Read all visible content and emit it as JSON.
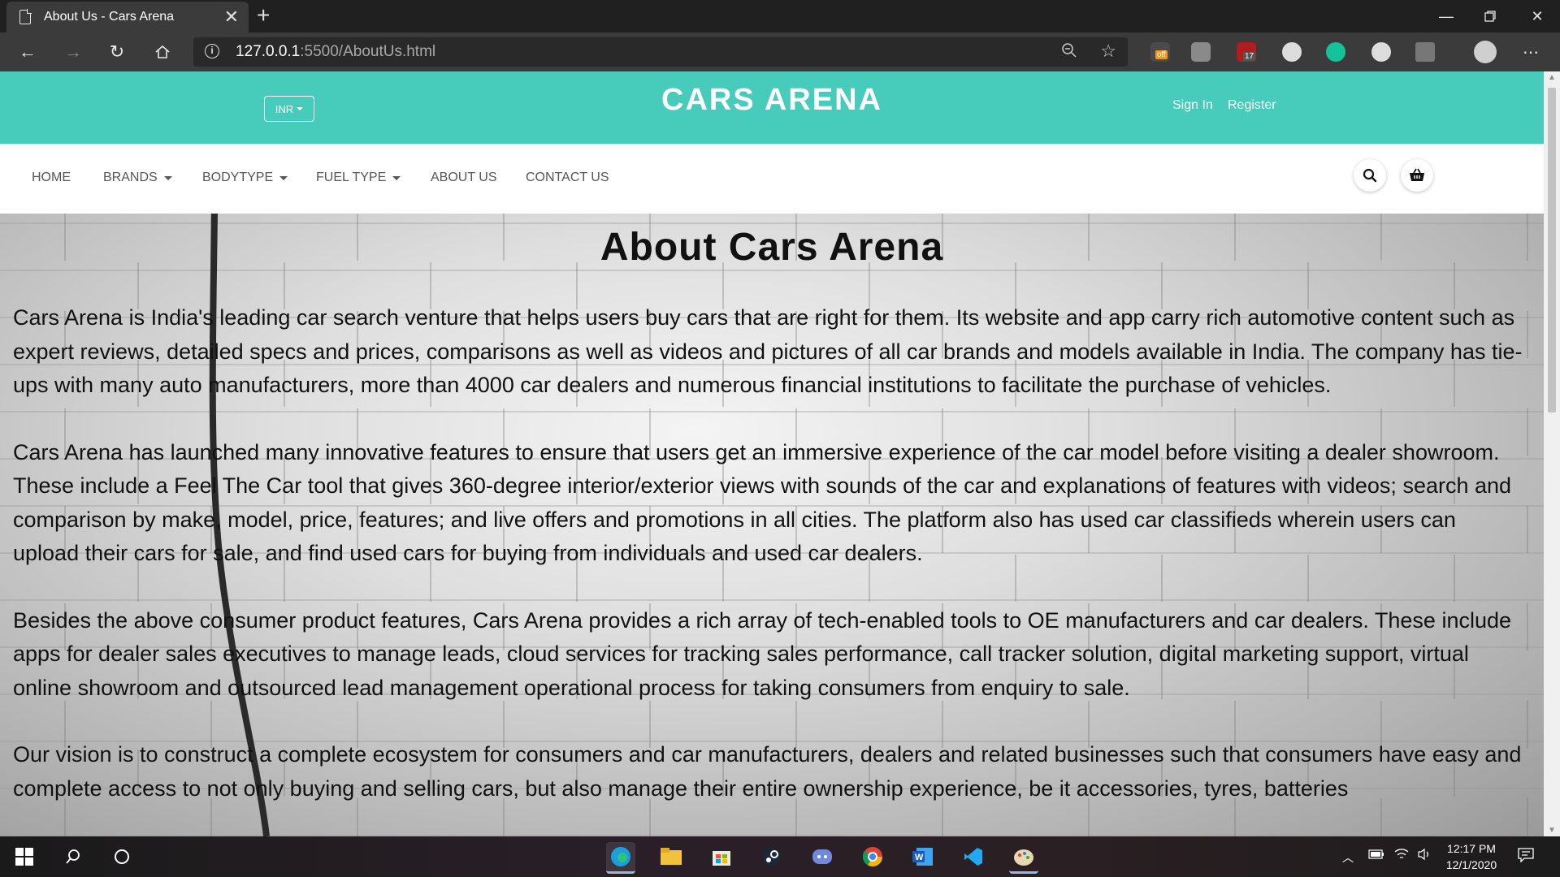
{
  "browser": {
    "tab_title": "About Us - Cars Arena",
    "url_host": "127.0.0.1",
    "url_rest": ":5500/AboutUs.html",
    "extension_badges": {
      "off": "off",
      "count": "17"
    }
  },
  "header": {
    "currency": "INR",
    "logo": "CARS ARENA",
    "sign_in": "Sign In",
    "register": "Register"
  },
  "nav": {
    "items": [
      "HOME",
      "BRANDS",
      "BODYTYPE",
      "FUEL TYPE",
      "ABOUT US",
      "CONTACT US"
    ]
  },
  "about": {
    "title": "About Cars Arena",
    "paragraphs": [
      "Cars Arena is India's leading car search venture that helps users buy cars that are right for them. Its website and app carry rich automotive content such as expert reviews, detailed specs and prices, comparisons as well as videos and pictures of all car brands and models available in India. The company has tie-ups with many auto manufacturers, more than 4000 car dealers and numerous financial institutions to facilitate the purchase of vehicles.",
      "Cars Arena has launched many innovative features to ensure that users get an immersive experience of the car model before visiting a dealer showroom. These include a Feel The Car tool that gives 360-degree interior/exterior views with sounds of the car and explanations of features with videos; search and comparison by make, model, price, features; and live offers and promotions in all cities. The platform also has used car classifieds wherein users can upload their cars for sale, and find used cars for buying from individuals and used car dealers.",
      "Besides the above consumer product features, Cars Arena provides a rich array of tech-enabled tools to OE manufacturers and car dealers. These include apps for dealer sales executives to manage leads, cloud services for tracking sales performance, call tracker solution, digital marketing support, virtual online showroom and outsourced lead management operational process for taking consumers from enquiry to sale.",
      "Our vision is to construct a complete ecosystem for consumers and car manufacturers, dealers and related businesses such that consumers have easy and complete access to not only buying and selling cars, but also manage their entire ownership experience, be it accessories, tyres, batteries"
    ]
  },
  "taskbar": {
    "time": "12:17 PM",
    "date": "12/1/2020"
  },
  "colors": {
    "header_bg": "#47cbbb",
    "browser_toolbar": "#3b3b3b"
  }
}
